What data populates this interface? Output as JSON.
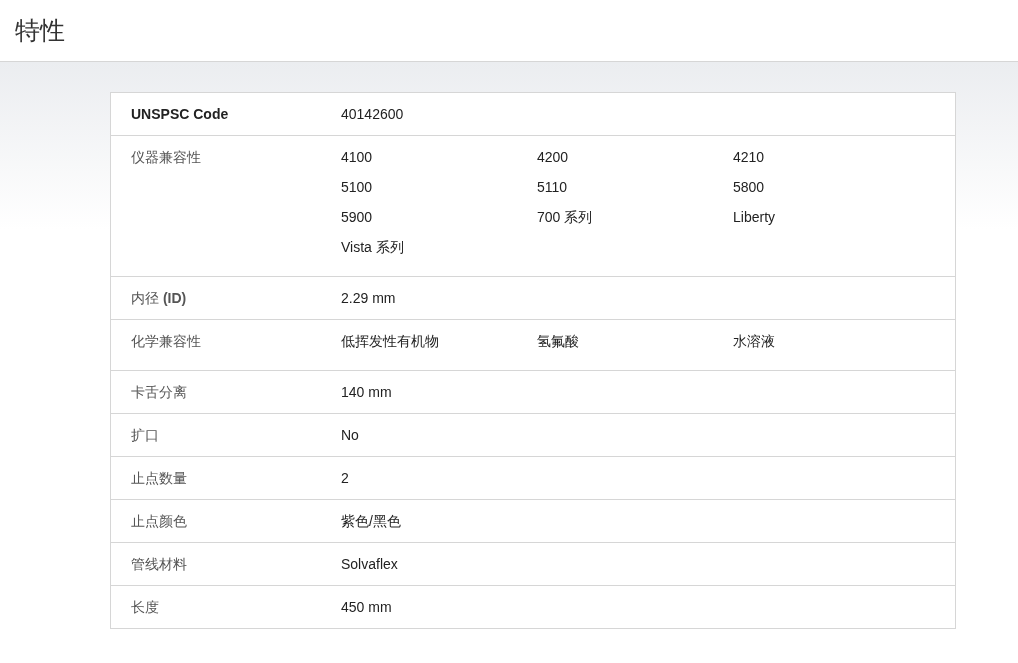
{
  "page_title": "特性",
  "rows": [
    {
      "label": "UNSPSC Code",
      "bold": true,
      "values": [
        "40142600"
      ]
    },
    {
      "label": "仪器兼容性",
      "bold": false,
      "values": [
        "4100",
        "4200",
        "4210",
        "5100",
        "5110",
        "5800",
        "5900",
        "700 系列",
        "Liberty",
        "Vista 系列"
      ]
    },
    {
      "label": "内径 **(ID)**",
      "bold": false,
      "values": [
        "2.29 mm"
      ]
    },
    {
      "label": "化学兼容性",
      "bold": false,
      "values": [
        "低挥发性有机物",
        "氢氟酸",
        "水溶液"
      ]
    },
    {
      "label": "卡舌分离",
      "bold": false,
      "values": [
        "140 mm"
      ]
    },
    {
      "label": "扩口",
      "bold": false,
      "values": [
        "No"
      ]
    },
    {
      "label": "止点数量",
      "bold": false,
      "values": [
        "2"
      ]
    },
    {
      "label": "止点颜色",
      "bold": false,
      "values": [
        "紫色/黑色"
      ]
    },
    {
      "label": "管线材料",
      "bold": false,
      "values": [
        "Solvaflex"
      ]
    },
    {
      "label": "长度",
      "bold": false,
      "values": [
        "450 mm"
      ]
    }
  ]
}
